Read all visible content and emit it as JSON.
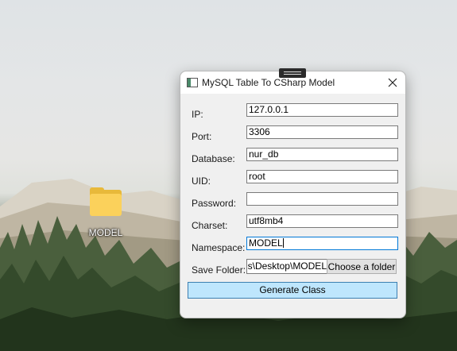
{
  "desktop": {
    "folder_label": "MODEL"
  },
  "window": {
    "title": "MySQL Table To CSharp Model",
    "close_symbol": "×",
    "fields": [
      {
        "label": "IP:",
        "value": "127.0.0.1"
      },
      {
        "label": "Port:",
        "value": "3306"
      },
      {
        "label": "Database:",
        "value": "nur_db"
      },
      {
        "label": "UID:",
        "value": "root"
      },
      {
        "label": "Password:",
        "value": ""
      },
      {
        "label": "Charset:",
        "value": "utf8mb4"
      },
      {
        "label": "Namespace:",
        "value": "MODEL"
      }
    ],
    "save_folder": {
      "label": "Save Folder:",
      "value": "s\\Desktop\\MODEL",
      "button_label": "Choose a folder"
    },
    "generate_label": "Generate Class"
  },
  "colors": {
    "folder": "#fbd15b",
    "generate_button_bg": "#bee6fd",
    "generate_button_border": "#3c7fb1",
    "focus_border": "#0078d7"
  },
  "icons": [
    "folder-icon",
    "app-window-icon",
    "close-icon",
    "drag-handle-icon"
  ]
}
